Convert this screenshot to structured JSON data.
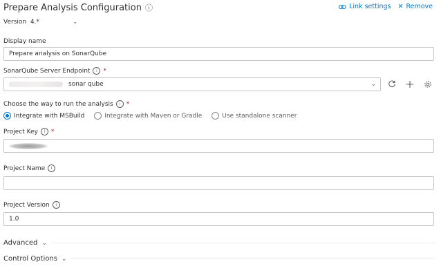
{
  "header": {
    "title": "Prepare Analysis Configuration",
    "link_settings": "Link settings",
    "remove": "Remove"
  },
  "version": {
    "label": "Version",
    "value": "4.*"
  },
  "fields": {
    "display_name": {
      "label": "Display name",
      "value": "Prepare analysis on SonarQube"
    },
    "endpoint": {
      "label": "SonarQube Server Endpoint",
      "value": "sonar qube"
    },
    "run_way": {
      "label": "Choose the way to run the analysis",
      "options": [
        "Integrate with MSBuild",
        "Integrate with Maven or Gradle",
        "Use standalone scanner"
      ],
      "selected": "Integrate with MSBuild"
    },
    "project_key": {
      "label": "Project Key"
    },
    "project_name": {
      "label": "Project Name",
      "value": ""
    },
    "project_version": {
      "label": "Project Version",
      "value": "1.0"
    }
  },
  "sections": {
    "advanced": "Advanced",
    "control_options": "Control Options"
  },
  "colors": {
    "accent": "#0078d4",
    "required": "#a4262c",
    "border": "#c8c6c4"
  }
}
